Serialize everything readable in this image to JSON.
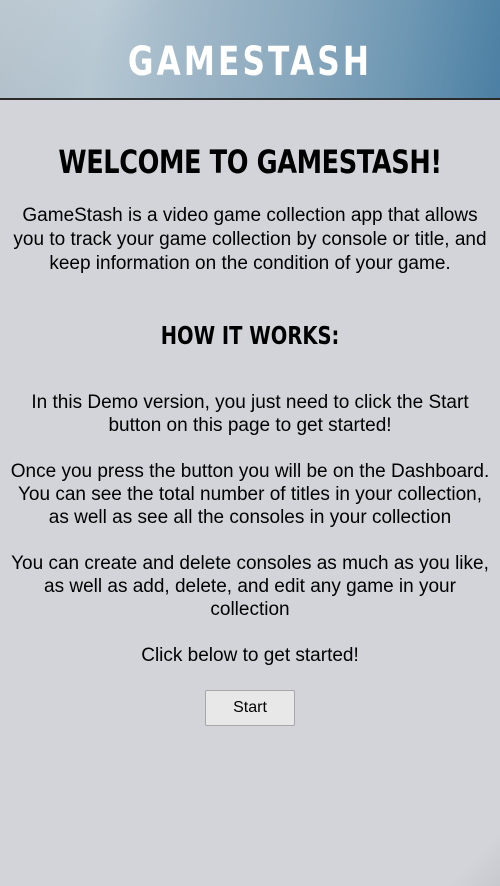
{
  "header": {
    "title": "GAMESTASH"
  },
  "main": {
    "welcome_heading": "WELCOME TO GAMESTASH!",
    "intro": "GameStash is a video game collection app that allows you to track your game collection by console or title, and keep information on the condition of your game.",
    "how_heading": "HOW IT WORKS:",
    "paragraphs": [
      "In this Demo version, you just need to click the Start button on this page to get started!",
      "Once you press the button you will be on the Dashboard. You can see the total number of titles in your collection, as well as see all the consoles in your collection",
      "You can create and delete consoles as much as you like, as well as add, delete, and edit any game in your collection",
      "Click below to get started!"
    ],
    "start_label": "Start"
  },
  "colors": {
    "background": "#d2d4d9",
    "header_gradient_start": "#aab9c4",
    "header_gradient_end": "#4b7fa3",
    "header_text": "#ffffff"
  }
}
